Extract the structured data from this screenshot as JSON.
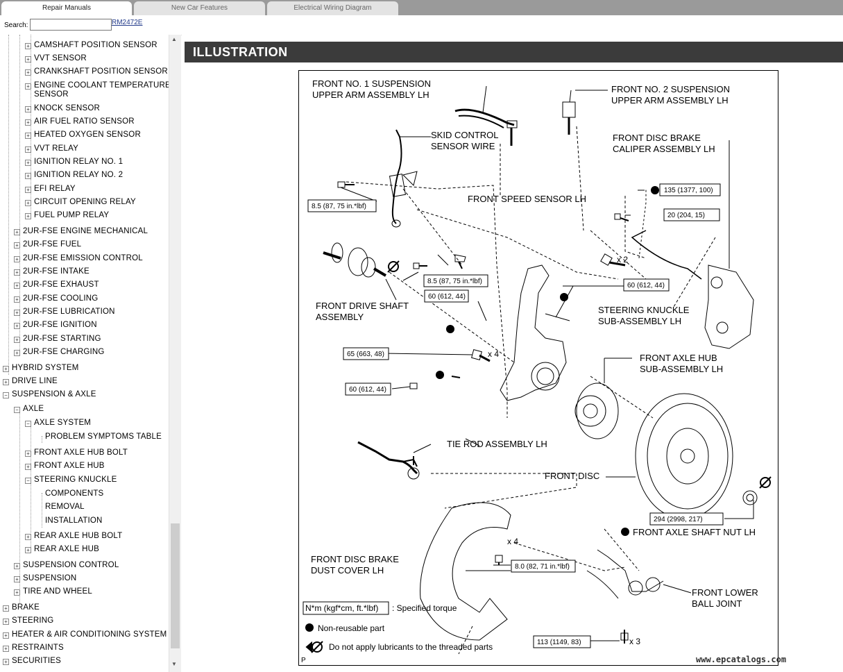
{
  "tabs": [
    "Repair Manuals",
    "New Car Features",
    "Electrical Wiring Diagram"
  ],
  "search": {
    "label": "Search:",
    "value": "",
    "code": "RM2472E"
  },
  "tree": [
    {
      "label": "CAMSHAFT POSITION SENSOR",
      "state": "+"
    },
    {
      "label": "VVT SENSOR",
      "state": "+"
    },
    {
      "label": "CRANKSHAFT POSITION SENSOR",
      "state": "+"
    },
    {
      "label": "ENGINE COOLANT TEMPERATURE",
      "label2": "SENSOR",
      "state": "+"
    },
    {
      "label": "KNOCK SENSOR",
      "state": "+"
    },
    {
      "label": "AIR FUEL RATIO SENSOR",
      "state": "+"
    },
    {
      "label": "HEATED OXYGEN SENSOR",
      "state": "+"
    },
    {
      "label": "VVT RELAY",
      "state": "+"
    },
    {
      "label": "IGNITION RELAY NO. 1",
      "state": "+"
    },
    {
      "label": "IGNITION RELAY NO. 2",
      "state": "+"
    },
    {
      "label": "EFI RELAY",
      "state": "+"
    },
    {
      "label": "CIRCUIT OPENING RELAY",
      "state": "+"
    },
    {
      "label": "FUEL PUMP RELAY",
      "state": "+"
    },
    {
      "label": "2UR-FSE ENGINE MECHANICAL",
      "state": "+"
    },
    {
      "label": "2UR-FSE FUEL",
      "state": "+"
    },
    {
      "label": "2UR-FSE EMISSION CONTROL",
      "state": "+"
    },
    {
      "label": "2UR-FSE INTAKE",
      "state": "+"
    },
    {
      "label": "2UR-FSE EXHAUST",
      "state": "+"
    },
    {
      "label": "2UR-FSE COOLING",
      "state": "+"
    },
    {
      "label": "2UR-FSE LUBRICATION",
      "state": "+"
    },
    {
      "label": "2UR-FSE IGNITION",
      "state": "+"
    },
    {
      "label": "2UR-FSE STARTING",
      "state": "+"
    },
    {
      "label": "2UR-FSE CHARGING",
      "state": "+"
    },
    {
      "label": "HYBRID SYSTEM",
      "state": "+"
    },
    {
      "label": "DRIVE LINE",
      "state": "+"
    },
    {
      "label": "SUSPENSION & AXLE",
      "state": "-"
    },
    {
      "label": "AXLE",
      "state": "-"
    },
    {
      "label": "AXLE SYSTEM",
      "state": "-"
    },
    {
      "label": "PROBLEM SYMPTOMS TABLE",
      "state": ""
    },
    {
      "label": "FRONT AXLE HUB BOLT",
      "state": "+"
    },
    {
      "label": "FRONT AXLE HUB",
      "state": "+"
    },
    {
      "label": "STEERING KNUCKLE",
      "state": "-"
    },
    {
      "label": "COMPONENTS",
      "state": ""
    },
    {
      "label": "REMOVAL",
      "state": ""
    },
    {
      "label": "INSTALLATION",
      "state": ""
    },
    {
      "label": "REAR AXLE HUB BOLT",
      "state": "+"
    },
    {
      "label": "REAR AXLE HUB",
      "state": "+"
    },
    {
      "label": "SUSPENSION CONTROL",
      "state": "+"
    },
    {
      "label": "SUSPENSION",
      "state": "+"
    },
    {
      "label": "TIRE AND WHEEL",
      "state": "+"
    },
    {
      "label": "BRAKE",
      "state": "+"
    },
    {
      "label": "STEERING",
      "state": "+"
    },
    {
      "label": "HEATER & AIR CONDITIONING SYSTEM",
      "state": "+"
    },
    {
      "label": "RESTRAINTS",
      "state": "+"
    },
    {
      "label": "SECURITIES",
      "state": "+"
    }
  ],
  "page": {
    "title": "ILLUSTRATION"
  },
  "figure": {
    "labels": {
      "upper_arm_1": [
        "FRONT NO. 1 SUSPENSION",
        "UPPER ARM ASSEMBLY LH"
      ],
      "upper_arm_2": [
        "FRONT NO. 2 SUSPENSION",
        "UPPER ARM ASSEMBLY LH"
      ],
      "skid_wire": [
        "SKID CONTROL",
        "SENSOR WIRE"
      ],
      "caliper": [
        "FRONT DISC BRAKE",
        "CALIPER ASSEMBLY LH"
      ],
      "speed_sensor": [
        "FRONT SPEED SENSOR LH"
      ],
      "drive_shaft": [
        "FRONT DRIVE SHAFT",
        "ASSEMBLY"
      ],
      "knuckle": [
        "STEERING KNUCKLE",
        "SUB-ASSEMBLY LH"
      ],
      "axle_hub": [
        "FRONT AXLE HUB",
        "SUB-ASSEMBLY LH"
      ],
      "tie_rod": [
        "TIE ROD ASSEMBLY LH"
      ],
      "front_disc": [
        "FRONT DISC"
      ],
      "shaft_nut": [
        "FRONT AXLE SHAFT NUT LH"
      ],
      "dust_cover": [
        "FRONT DISC BRAKE",
        "DUST COVER LH"
      ],
      "ball_joint": [
        "FRONT LOWER",
        "BALL JOINT"
      ]
    },
    "torques": {
      "t_wire": "8.5 (87, 75 in.*lbf)",
      "t_caliper": "135 (1377, 100)",
      "t_sensor_bracket": "20 (204, 15)",
      "t_sensor": "8.5 (87, 75 in.*lbf)",
      "t_knuckle_nut": "60 (612, 44)",
      "t_upper_nut": "60 (612, 44)",
      "t_hub_bolts": "65 (663, 48)",
      "t_tierod_nut": "60 (612, 44)",
      "t_shaft_nut": "294 (2998, 217)",
      "t_dust": "8.0 (82, 71 in.*lbf)",
      "t_ball": "113 (1149, 83)"
    },
    "multipliers": {
      "x2": "x 2",
      "x4a": "x 4",
      "x4b": "x 4",
      "x3": "x 3"
    },
    "legend": {
      "unit": "N*m (kgf*cm, ft.*lbf)",
      "unit_desc": ": Specified torque",
      "nonreusable": "Non-reusable part",
      "nolube": "Do not apply lubricants to the threaded parts"
    },
    "corner": "P"
  },
  "watermark": "www.epcatalogs.com"
}
